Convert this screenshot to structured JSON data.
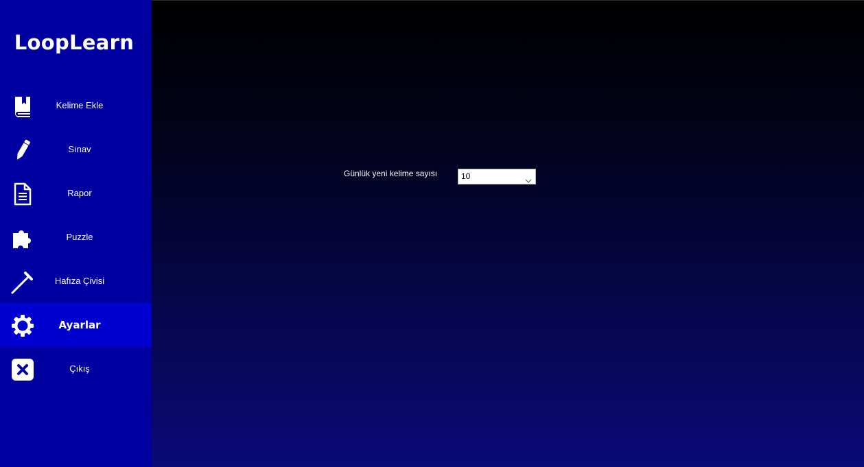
{
  "app": {
    "brand": "LoopLearn"
  },
  "sidebar": {
    "items": [
      {
        "label": "Kelime Ekle",
        "icon": "book-icon",
        "active": false
      },
      {
        "label": "Sınav",
        "icon": "pencil-icon",
        "active": false
      },
      {
        "label": "Rapor",
        "icon": "document-icon",
        "active": false
      },
      {
        "label": "Puzzle",
        "icon": "puzzle-icon",
        "active": false
      },
      {
        "label": "Hafıza Çivisi",
        "icon": "nail-icon",
        "active": false
      },
      {
        "label": "Ayarlar",
        "icon": "gear-icon",
        "active": true
      },
      {
        "label": "Çıkış",
        "icon": "close-icon",
        "active": false
      }
    ]
  },
  "settings": {
    "daily_words_label": "Günlük yeni kelime sayısı",
    "daily_words_value": "10"
  },
  "colors": {
    "sidebar": "#0000a0",
    "sidebar_active": "#0000d0",
    "main_gradient_top": "#000000",
    "main_gradient_bottom": "#0a0a78"
  }
}
